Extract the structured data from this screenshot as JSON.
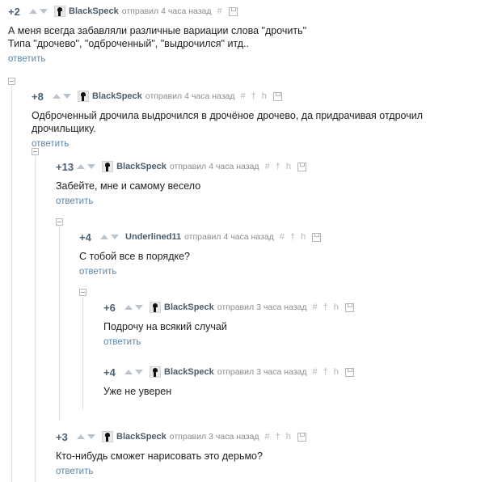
{
  "labels": {
    "meta_prefix": "отправил",
    "reply": "ответить"
  },
  "comments": [
    {
      "rating": "+2",
      "author": "BlackSpeck",
      "time": "4 часа назад",
      "lines": [
        "А меня всегда забавляли различные вариации слова \"дрочить\"",
        "Типа \"дрочево\", \"одброченный\", \"выдрочился\" итд.."
      ]
    },
    {
      "rating": "+8",
      "author": "BlackSpeck",
      "time": "4 часа назад",
      "lines": [
        "Одброченный дрочила выдрочился в дрочёное дрочево, да придрачивая отдрочил дрочильщику."
      ]
    },
    {
      "rating": "+13",
      "author": "BlackSpeck",
      "time": "4 часа назад",
      "lines": [
        "Забейте, мне и самому весело"
      ]
    },
    {
      "rating": "+4",
      "author": "Underlined11",
      "time": "4 часа назад",
      "lines": [
        "С тобой все в порядке?"
      ]
    },
    {
      "rating": "+6",
      "author": "BlackSpeck",
      "time": "3 часа назад",
      "lines": [
        "Подрочу на всякий случай"
      ]
    },
    {
      "rating": "+4",
      "author": "BlackSpeck",
      "time": "3 часа назад",
      "lines": [
        "Уже не уверен"
      ]
    },
    {
      "rating": "+3",
      "author": "BlackSpeck",
      "time": "3 часа назад",
      "lines": [
        "Кто-нибудь сможет нарисовать это дерьмо?"
      ]
    }
  ],
  "icons": {
    "link": "#",
    "parent": "†",
    "branch": "h"
  }
}
